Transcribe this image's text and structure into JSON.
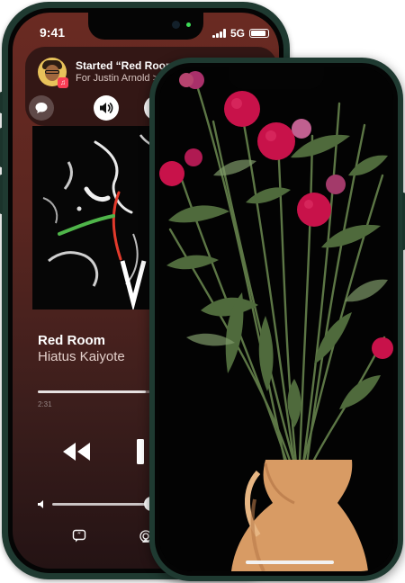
{
  "status_bar": {
    "time": "9:41",
    "network": "5G"
  },
  "shareplay": {
    "title": "Started “Red Room”",
    "subtitle": "For Justin Arnold",
    "chevron": ">",
    "app_badge_icon": "music-note-icon",
    "end_color": "#ff3b30"
  },
  "now_playing": {
    "song": "Red Room",
    "artist": "Hiatus Kaiyote",
    "elapsed": "2:31",
    "progress": 0.6,
    "volume": 0.92
  },
  "colors": {
    "background_top": "#6a2a22",
    "background_bottom": "#241314",
    "frame": "#1f3a31",
    "flower": "#c8124a",
    "stem": "#4f6a3c",
    "vase": "#d89b64"
  }
}
